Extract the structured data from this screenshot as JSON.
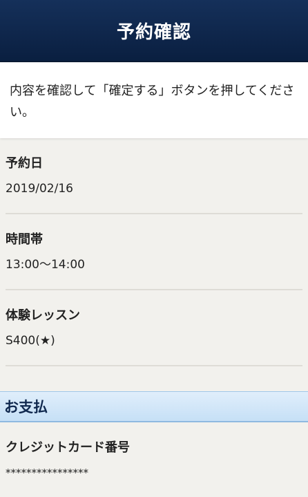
{
  "header": {
    "title": "予約確認"
  },
  "notice": {
    "text": "内容を確認して「確定する」ボタンを押してください。"
  },
  "fields": [
    {
      "label": "予約日",
      "value": "2019/02/16"
    },
    {
      "label": "時間帯",
      "value": "13:00〜14:00"
    },
    {
      "label": "体験レッスン",
      "value": "S400(★)"
    }
  ],
  "payment": {
    "section_title": "お支払",
    "card_label": "クレジットカード番号",
    "card_value": "****************"
  }
}
